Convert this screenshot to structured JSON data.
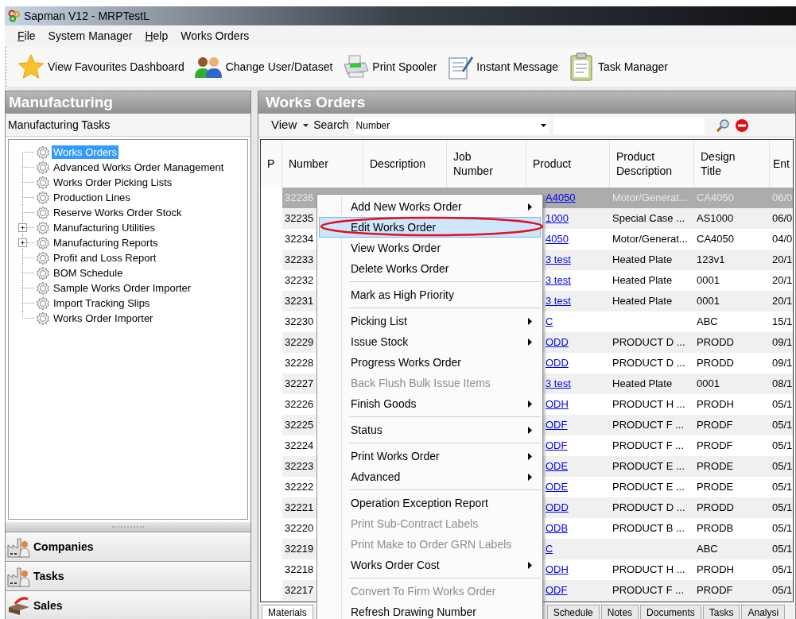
{
  "window": {
    "title": "Sapman V12 - MRPTestL"
  },
  "menu_bar": [
    {
      "label": "File",
      "mnemonic": true
    },
    {
      "label": "System Manager",
      "mnemonic": false
    },
    {
      "label": "Help",
      "mnemonic": true
    },
    {
      "label": "Works Orders",
      "mnemonic": false
    }
  ],
  "toolbar": [
    {
      "label": "View Favourites Dashboard",
      "kind": "star"
    },
    {
      "label": "Change User/Dataset",
      "kind": "users"
    },
    {
      "label": "Print Spooler",
      "kind": "printer"
    },
    {
      "label": "Instant Message",
      "kind": "message"
    },
    {
      "label": "Task Manager",
      "kind": "clipboard"
    }
  ],
  "sidebar": {
    "title": "Manufacturing",
    "subtitle": "Manufacturing Tasks",
    "items": [
      {
        "label": "Works Orders",
        "selected": true
      },
      {
        "label": "Advanced Works Order Management",
        "selected": false
      },
      {
        "label": "Works Order Picking Lists",
        "selected": false
      },
      {
        "label": "Production Lines",
        "selected": false
      },
      {
        "label": "Reserve Works Order Stock",
        "selected": false
      },
      {
        "label": "Manufacturing Utilities",
        "selected": false,
        "expanded": false
      },
      {
        "label": "Manufacturing Reports",
        "selected": false,
        "expanded": false
      },
      {
        "label": "Profit and Loss Report",
        "selected": false
      },
      {
        "label": "BOM Schedule",
        "selected": false
      },
      {
        "label": "Sample Works Order Importer",
        "selected": false
      },
      {
        "label": "Import Tracking Slips",
        "selected": false
      },
      {
        "label": "Works Order Importer",
        "selected": false
      }
    ],
    "sections": [
      {
        "label": "Companies",
        "kind": "factory"
      },
      {
        "label": "Tasks",
        "kind": "factory"
      },
      {
        "label": "Sales",
        "kind": "sales"
      }
    ]
  },
  "main": {
    "title": "Works Orders",
    "view_label": "View",
    "search_label": "Search",
    "search_field": "Number",
    "table": {
      "columns": [
        "P",
        "Number",
        "Description",
        "Job\nNumber",
        "Product",
        "Product\nDescription",
        "Design\nTitle",
        "Ent"
      ],
      "rows": [
        {
          "number": "32236",
          "product": "A4050",
          "product_description": "Motor/Generat...",
          "design_title": "CA4050",
          "column_8": "06/0",
          "selected": true
        },
        {
          "number": "32235",
          "product": "1000",
          "product_description": "Special Case ...",
          "design_title": "AS1000",
          "column_8": "06/0",
          "selected": false
        },
        {
          "number": "32234",
          "product": "4050",
          "product_description": "Motor/Generat...",
          "design_title": "CA4050",
          "column_8": "04/0",
          "selected": false
        },
        {
          "number": "32233",
          "product": "3 test",
          "product_description": "Heated Plate",
          "design_title": "123v1",
          "column_8": "20/1",
          "selected": false
        },
        {
          "number": "32232",
          "product": "3 test",
          "product_description": "Heated Plate",
          "design_title": "0001",
          "column_8": "20/1",
          "selected": false
        },
        {
          "number": "32231",
          "product": "3 test",
          "product_description": "Heated Plate",
          "design_title": "0001",
          "column_8": "20/1",
          "selected": false
        },
        {
          "number": "32230",
          "product": "C",
          "design_title": "ABC",
          "column_8": "15/1",
          "selected": false
        },
        {
          "number": "32229",
          "product": "ODD",
          "product_description": "PRODUCT D ...",
          "design_title": "PRODD",
          "column_8": "09/1",
          "selected": false
        },
        {
          "number": "32228",
          "product": "ODD",
          "product_description": "PRODUCT D ...",
          "design_title": "PRODD",
          "column_8": "09/1",
          "selected": false
        },
        {
          "number": "32227",
          "product": "3 test",
          "product_description": "Heated Plate",
          "design_title": "0001",
          "column_8": "08/1",
          "selected": false
        },
        {
          "number": "32226",
          "product": "ODH",
          "product_description": "PRODUCT H ...",
          "design_title": "PRODH",
          "column_8": "05/1",
          "selected": false
        },
        {
          "number": "32225",
          "product": "ODF",
          "product_description": "PRODUCT F ...",
          "design_title": "PRODF",
          "column_8": "05/1",
          "selected": false
        },
        {
          "number": "32224",
          "product": "ODF",
          "product_description": "PRODUCT F ...",
          "design_title": "PRODF",
          "column_8": "05/1",
          "selected": false
        },
        {
          "number": "32223",
          "product": "ODE",
          "product_description": "PRODUCT E ...",
          "design_title": "PRODE",
          "column_8": "05/1",
          "selected": false
        },
        {
          "number": "32222",
          "product": "ODE",
          "product_description": "PRODUCT E ...",
          "design_title": "PRODE",
          "column_8": "05/1",
          "selected": false
        },
        {
          "number": "32221",
          "product": "ODD",
          "product_description": "PRODUCT D ...",
          "design_title": "PRODD",
          "column_8": "05/1",
          "selected": false
        },
        {
          "number": "32220",
          "product": "ODB",
          "product_description": "PRODUCT B ...",
          "design_title": "PRODB",
          "column_8": "05/1",
          "selected": false
        },
        {
          "number": "32219",
          "product": "C",
          "design_title": "ABC",
          "column_8": "05/1",
          "selected": false
        },
        {
          "number": "32218",
          "product": "ODH",
          "product_description": "PRODUCT H ...",
          "design_title": "PRODH",
          "column_8": "05/1",
          "selected": false
        },
        {
          "number": "32217",
          "product": "ODF",
          "product_description": "PRODUCT F ...",
          "design_title": "PRODF",
          "column_8": "05/1",
          "selected": false
        }
      ]
    },
    "tabs": [
      {
        "label": "Materials",
        "selected": true
      },
      {
        "label": "Schedule",
        "selected": false
      },
      {
        "label": "Notes",
        "selected": false
      },
      {
        "label": "Documents",
        "selected": false
      },
      {
        "label": "Tasks",
        "selected": false
      },
      {
        "label": "Analysi",
        "selected": false
      }
    ]
  },
  "context_menu": [
    {
      "kind": "item",
      "label": "Add New Works Order",
      "submenu": true,
      "disabled": false,
      "selected": false
    },
    {
      "kind": "item",
      "label": "Edit Works Order",
      "submenu": false,
      "disabled": false,
      "selected": true,
      "circled": true
    },
    {
      "kind": "item",
      "label": "View Works Order",
      "submenu": false,
      "disabled": false,
      "selected": false
    },
    {
      "kind": "item",
      "label": "Delete Works Order",
      "submenu": false,
      "disabled": false,
      "selected": false
    },
    {
      "kind": "separator"
    },
    {
      "kind": "item",
      "label": "Mark as High Priority",
      "submenu": false,
      "disabled": false,
      "selected": false
    },
    {
      "kind": "separator"
    },
    {
      "kind": "item",
      "label": "Picking List",
      "submenu": true,
      "disabled": false,
      "selected": false
    },
    {
      "kind": "item",
      "label": "Issue Stock",
      "submenu": true,
      "disabled": false,
      "selected": false
    },
    {
      "kind": "item",
      "label": "Progress Works Order",
      "submenu": false,
      "disabled": false,
      "selected": false
    },
    {
      "kind": "item",
      "label": "Back Flush Bulk Issue Items",
      "submenu": false,
      "disabled": true,
      "selected": false
    },
    {
      "kind": "item",
      "label": "Finish Goods",
      "submenu": true,
      "disabled": false,
      "selected": false
    },
    {
      "kind": "separator"
    },
    {
      "kind": "item",
      "label": "Status",
      "submenu": true,
      "disabled": false,
      "selected": false
    },
    {
      "kind": "separator"
    },
    {
      "kind": "item",
      "label": "Print Works Order",
      "submenu": true,
      "disabled": false,
      "selected": false
    },
    {
      "kind": "item",
      "label": "Advanced",
      "submenu": true,
      "disabled": false,
      "selected": false
    },
    {
      "kind": "separator"
    },
    {
      "kind": "item",
      "label": "Operation Exception Report",
      "submenu": false,
      "disabled": false,
      "selected": false
    },
    {
      "kind": "item",
      "label": "Print Sub-Contract Labels",
      "submenu": false,
      "disabled": true,
      "selected": false
    },
    {
      "kind": "item",
      "label": "Print Make to Order GRN Labels",
      "submenu": false,
      "disabled": true,
      "selected": false
    },
    {
      "kind": "item",
      "label": "Works Order Cost",
      "submenu": true,
      "disabled": false,
      "selected": false
    },
    {
      "kind": "separator"
    },
    {
      "kind": "item",
      "label": "Convert To Firm Works Order",
      "submenu": false,
      "disabled": true,
      "selected": false
    },
    {
      "kind": "item",
      "label": "Refresh Drawing Number",
      "submenu": false,
      "disabled": false,
      "selected": false
    }
  ]
}
